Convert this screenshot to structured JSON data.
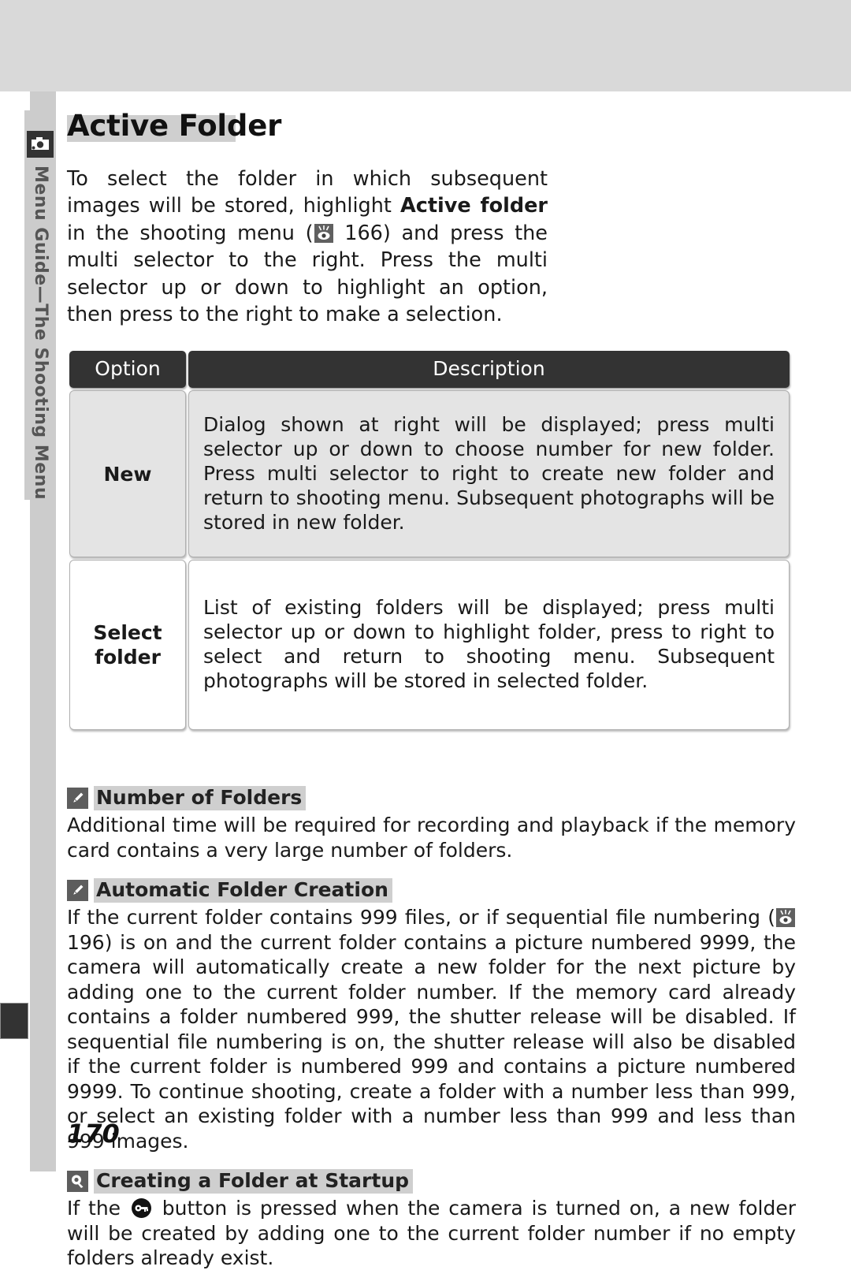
{
  "sidebar": {
    "icon": "camera-icon",
    "label": "Menu Guide—The Shooting Menu"
  },
  "page": {
    "title": "Active Folder",
    "number": "170"
  },
  "intro": {
    "part1": "To select the folder in which subsequent images will be stored, highlight ",
    "bold": "Active folder",
    "part2": " in the shooting menu (",
    "ref_icon": "reference-eye-icon",
    "ref_page": " 166) and press the multi selector to the right.  Press the multi selector up or down to highlight an option, then press to the right to make a selection."
  },
  "table": {
    "headers": {
      "option": "Option",
      "description": "Description"
    },
    "rows": [
      {
        "option": "New",
        "description": "Dialog shown at right will be displayed; press multi selector up or down to choose number for new folder.  Press multi selector to right to create new folder and return to shooting menu.  Subsequent photographs will be stored in new folder."
      },
      {
        "option": "Select folder",
        "description": "List of existing folders will be displayed; press multi selector up or down to highlight folder, press to right to select and return to shooting menu.  Subsequent photographs will be stored in selected folder."
      }
    ]
  },
  "notes": [
    {
      "icon": "pencil-icon",
      "title": "Number of Folders",
      "body": "Additional time will be required for recording and playback if the memory card contains a very large number of folders."
    },
    {
      "icon": "pencil-icon",
      "title": "Automatic Folder Creation",
      "body_part1": "If the current folder contains 999 files, or if sequential file numbering (",
      "ref_icon": "reference-eye-icon",
      "body_part2": " 196) is on and the current folder contains a picture numbered 9999, the camera will automatically create a new folder for the next picture by adding one to the current folder number.  If the memory card already contains a folder numbered 999, the shutter release will be disabled.  If sequential file numbering is on, the shutter release will also be disabled if the current folder is numbered 999 and contains a picture numbered 9999.   To continue shooting, create a folder with a number less than 999, or select an existing folder with a number less than 999 and less than 999 images."
    },
    {
      "icon": "magnifier-tip-icon",
      "title": "Creating a Folder at Startup",
      "body_part1": "If the ",
      "key_icon": "key-button-icon",
      "body_part2": " button is pressed when the camera is turned on, a new folder will be created by adding one to the current folder number if no empty folders already exist."
    }
  ],
  "colors": {
    "top_band": "#d9d9d9",
    "side_strip": "#cccccc",
    "header_dark": "#333333",
    "row_new_bg": "#e4e4e4",
    "highlight": "#cfcfcf"
  }
}
